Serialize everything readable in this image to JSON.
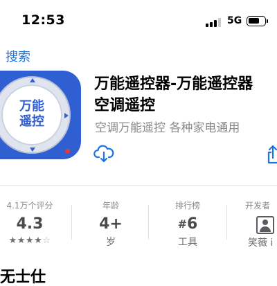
{
  "status_bar": {
    "time": "12:53",
    "network": "5G"
  },
  "nav": {
    "back_label": "搜索"
  },
  "app": {
    "icon_line1": "万能",
    "icon_line2": "遥控",
    "title_line1": "万能遥控器-万能遥控器",
    "title_line2": "空调遥控",
    "subtitle": "空调万能遥控 各种家电通用"
  },
  "stats": {
    "ratings": {
      "label": "4.1万个评分",
      "value": "4.3",
      "stars_filled": "★★★★",
      "stars_empty": "☆"
    },
    "age": {
      "label": "年龄",
      "value": "4+",
      "sub": "岁"
    },
    "rank": {
      "label": "排行榜",
      "hash": "#",
      "value": "6",
      "sub": "工具"
    },
    "developer": {
      "label": "开发者",
      "sub": "笑薇 i"
    }
  },
  "bottom": {
    "heading": "无士仕"
  },
  "colors": {
    "accent": "#1a73e8",
    "icon_blue": "#2f5fd0"
  }
}
